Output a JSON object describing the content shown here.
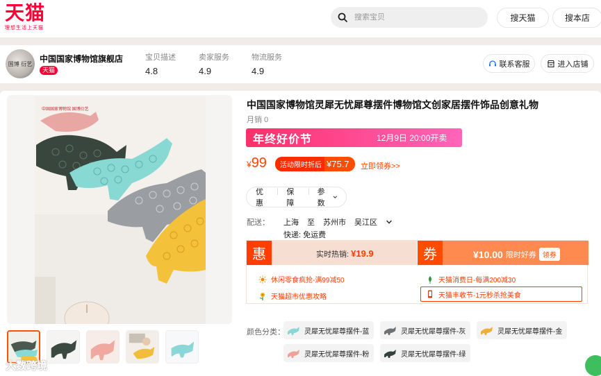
{
  "brand": {
    "logo": "天猫",
    "slogan": "理想生活上天猫"
  },
  "search": {
    "placeholder": "搜索宝贝"
  },
  "header": {
    "btn_tmall": "搜天猫",
    "btn_store": "搜本店"
  },
  "shop": {
    "avatar_text": "国博 衍艺",
    "name": "中国国家博物馆旗舰店",
    "badge": "天猫",
    "metrics": [
      {
        "label": "宝贝描述",
        "value": "4.8"
      },
      {
        "label": "卖家服务",
        "value": "4.9"
      },
      {
        "label": "物流服务",
        "value": "4.9"
      }
    ],
    "service_label": "联系客服",
    "enter_label": "进入店铺"
  },
  "product": {
    "title": "中国国家博物馆灵犀无忧犀尊摆件博物馆文创家居摆件饰品创意礼物",
    "sales": "月销 0",
    "promo_title": "年终好价节",
    "promo_time": "12月9日 20:00开卖",
    "price_symbol": "¥",
    "price": "99",
    "deal_label": "活动限时折后",
    "deal_price": "¥75.7",
    "claim_link": "立即领券>>",
    "tabs": [
      "优惠",
      "保障",
      "参数"
    ],
    "image_text": "中国国家博物馆 国博衍艺"
  },
  "shipping": {
    "label": "配送：",
    "from": "上海",
    "to_word": "至",
    "city": "苏州市",
    "district": "吴江区",
    "fee": "快递: 免运费"
  },
  "coupons": {
    "hui_tag": "惠",
    "hui_text": "实时热销:",
    "hui_price": "¥19.9",
    "quan_tag": "券",
    "quan_amount": "¥10.00",
    "quan_text": "限时好券",
    "quan_button": "领券",
    "items": [
      "休闲零食疯抢-满99减50",
      "天猫消费日-每满200减30",
      "天猫超市优惠攻略",
      "天猫丰收节-1元秒杀抢美食"
    ]
  },
  "variants": {
    "label": "颜色分类：",
    "options": [
      "灵犀无忧犀尊摆件-蓝",
      "灵犀无忧犀尊摆件-灰",
      "灵犀无忧犀尊摆件-金",
      "灵犀无忧犀尊摆件-粉",
      "灵犀无忧犀尊摆件-绿"
    ]
  },
  "watermark": "大数跨境",
  "colors": {
    "tmall_red": "#ff0036",
    "price_orange": "#ff4400",
    "promo_pink": "#ff3f7f"
  },
  "icons": [
    "search-icon",
    "headset-icon",
    "shop-icon",
    "chevron-down-icon",
    "sun-icon",
    "leaf-icon",
    "flower-icon",
    "phone-icon"
  ]
}
